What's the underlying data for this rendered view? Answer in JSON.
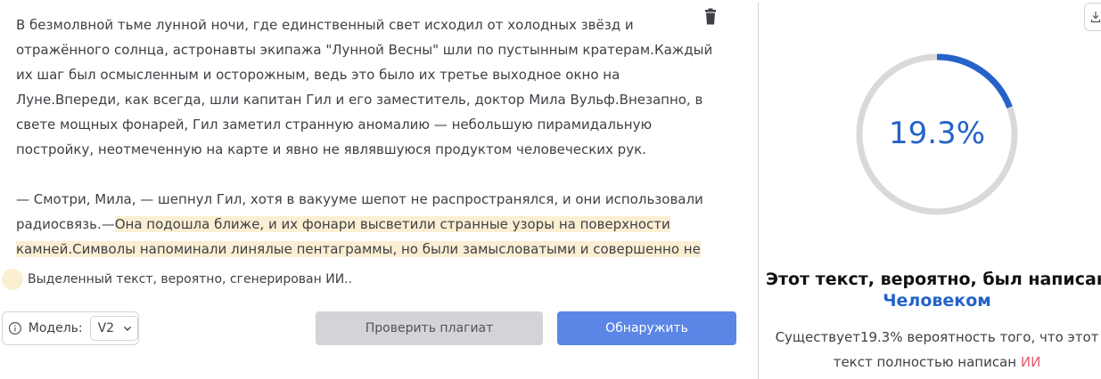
{
  "editor": {
    "paragraph1": "В безмолвной тьме лунной ночи, где единственный свет исходил от холодных звёзд и отражённого солнца, астронавты экипажа \"Лунной Весны\" шли по пустынным кратерам.Каждый их шаг был осмысленным и осторожным, ведь это было их третье выходное окно на Луне.Впереди, как всегда, шли капитан Гил и его заместитель, доктор Мила Вульф.Внезапно, в свете мощных фонарей, Гил заметил странную аномалию — небольшую пирамидальную постройку, неотмеченную на карте и явно не являвшуюся продуктом человеческих рук.",
    "paragraph2_plain": "— Смотри, Мила, — шепнул Гил, хотя в вакууме шепот не распространялся, и они использовали радиосвязь.—",
    "paragraph2_highlighted": "Она подошла ближе, и их фонари высветили странные узоры на поверхности камней.Символы напоминали линялые пентаграммы, но были замысловатыми и совершенно не знакомыми."
  },
  "legend": {
    "text": "Выделенный текст, вероятно, сгенерирован ИИ.."
  },
  "controls": {
    "model_label": "Модель:",
    "model_value": "V2",
    "plagiarism_button": "Проверить плагиат",
    "detect_button": "Обнаружить"
  },
  "result": {
    "percent_label": "19.3%",
    "ai_fraction": 0.193,
    "verdict_prefix": "Этот текст, вероятно, был написан",
    "verdict_author": "Человеком",
    "prob_prefix": "Существует19.3% вероятность того, что этот текст полностью написан",
    "prob_ai": "ИИ"
  },
  "colors": {
    "highlight": "#fbefd3",
    "accent_blue": "#2563c9",
    "gauge_track": "#d9d9d9",
    "gauge_arc": "#2563c9",
    "ai_red": "#e25d6e",
    "detect_button": "#5b86e5"
  },
  "icons": {
    "trash": "trash-icon",
    "info": "info-icon",
    "chevron": "chevron-down-icon",
    "download": "download-icon"
  }
}
